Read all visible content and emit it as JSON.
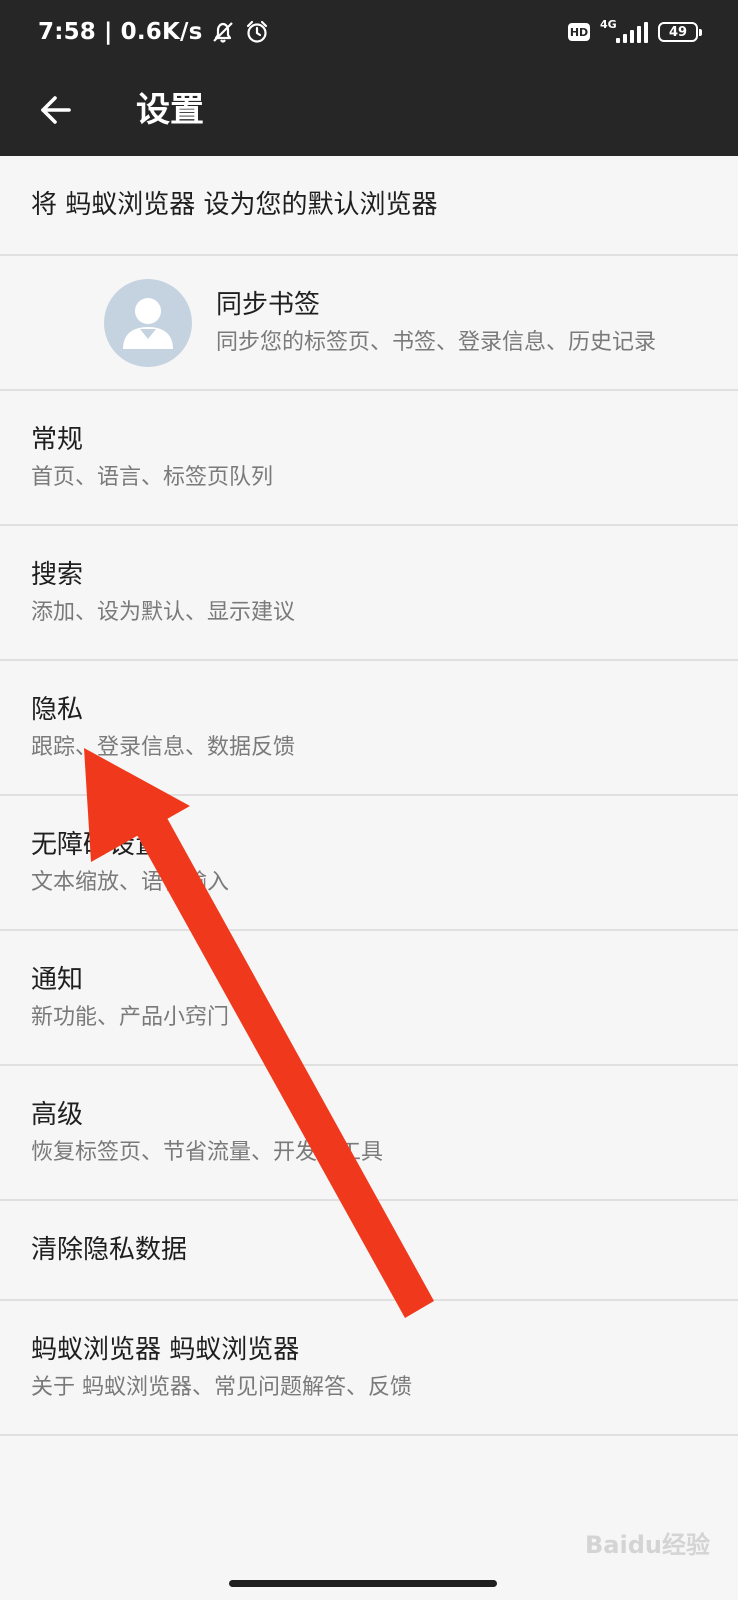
{
  "status_bar": {
    "time": "7:58",
    "speed": "0.6K/s",
    "hd_label": "HD",
    "network_label": "4G",
    "battery_level": "49",
    "icons": [
      "notification-mute-icon",
      "alarm-icon",
      "hd-icon",
      "signal-icon",
      "battery-icon"
    ],
    "signal_strength": 5
  },
  "app_bar": {
    "title": "设置",
    "back_icon": "arrow-left-icon"
  },
  "settings": {
    "default_browser": {
      "title": "将 蚂蚁浏览器 设为您的默认浏览器"
    },
    "sync": {
      "title": "同步书签",
      "subtitle": "同步您的标签页、书签、登录信息、历史记录",
      "avatar_icon": "user-avatar-icon"
    },
    "general": {
      "title": "常规",
      "subtitle": "首页、语言、标签页队列"
    },
    "search": {
      "title": "搜索",
      "subtitle": "添加、设为默认、显示建议"
    },
    "privacy": {
      "title": "隐私",
      "subtitle": "跟踪、登录信息、数据反馈"
    },
    "accessibility": {
      "title": "无障碍设置",
      "subtitle": "文本缩放、语音输入"
    },
    "notifications": {
      "title": "通知",
      "subtitle": "新功能、产品小窍门"
    },
    "advanced": {
      "title": "高级",
      "subtitle": "恢复标签页、节省流量、开发者工具"
    },
    "clear_data": {
      "title": "清除隐私数据"
    },
    "about": {
      "title": "蚂蚁浏览器 蚂蚁浏览器",
      "subtitle": "关于 蚂蚁浏览器、常见问题解答、反馈"
    }
  },
  "annotation": {
    "arrow_color": "#f0391c",
    "arrow_target": "privacy"
  },
  "watermark": {
    "text": "Baidu经验"
  },
  "colors": {
    "app_bar": "#262626",
    "background": "#f6f6f6",
    "divider": "#e0e0e0",
    "avatar": "#c5d3e1"
  }
}
